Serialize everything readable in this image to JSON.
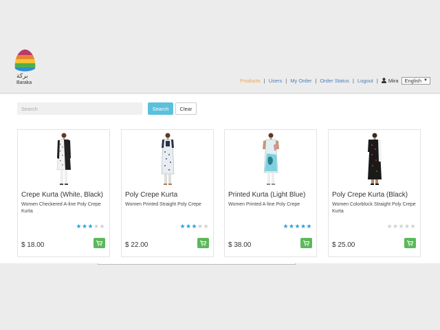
{
  "brand": {
    "name_ar": "بركة",
    "name_en": "Baraka",
    "logo_colors": [
      "#b83a6a",
      "#e8852f",
      "#f2c335",
      "#4fb04b",
      "#2f8fd0"
    ]
  },
  "nav": {
    "items": [
      {
        "label": "Products",
        "active": true
      },
      {
        "label": "Users",
        "active": false
      },
      {
        "label": "My Order",
        "active": false
      },
      {
        "label": "Order Status",
        "active": false
      },
      {
        "label": "Logout",
        "active": false
      }
    ],
    "user": "Mira",
    "language": "English"
  },
  "search": {
    "placeholder": "Search",
    "search_label": "Search",
    "clear_label": "Clear"
  },
  "products": [
    {
      "name": "Crepe Kurta (White, Black)",
      "description": "Women Checkered A-line Poly Crepe Kurta",
      "rating": 3,
      "price": "$ 18.00"
    },
    {
      "name": "Poly Crepe Kurta",
      "description": "Women Printed Straight Poly Crepe",
      "rating": 3,
      "price": "$ 22.00"
    },
    {
      "name": "Printed Kurta (Light Blue)",
      "description": "Women Printed A-line Poly Crepe",
      "rating": 5,
      "price": "$ 38.00"
    },
    {
      "name": "Poly Crepe Kurta (Black)",
      "description": "Women Colorblock Straight Poly Crepe Kurta",
      "rating": 0,
      "price": "$ 25.00"
    }
  ],
  "colors": {
    "accent": "#5bc0de",
    "link": "#4a7fb5",
    "active_link": "#f0a04b",
    "cart_button": "#5cb85c",
    "star_on": "#2aa0d9"
  }
}
